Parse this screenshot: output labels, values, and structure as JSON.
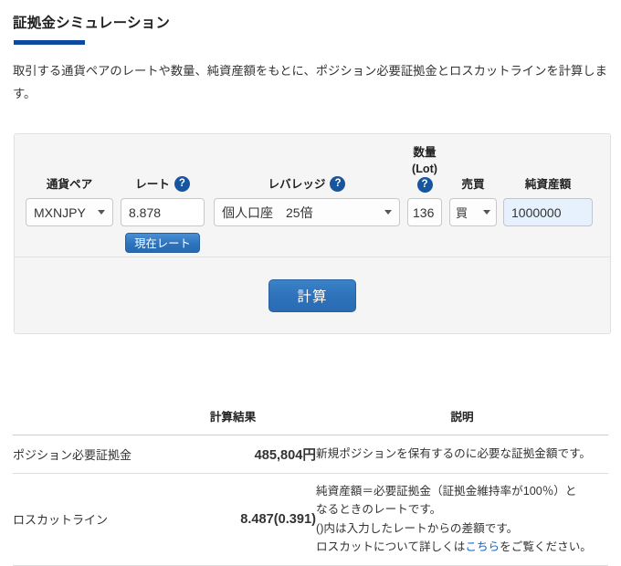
{
  "header": {
    "title": "証拠金シミュレーション",
    "lead": "取引する通貨ペアのレートや数量、純資産額をもとに、ポジション必要証拠金とロスカットラインを計算します。",
    "accent_color": "#0b4a9e"
  },
  "form": {
    "labels": {
      "pair": "通貨ペア",
      "rate": "レート",
      "leverage": "レバレッジ",
      "quantity_line1": "数量",
      "quantity_line2": "(Lot)",
      "side": "売買",
      "equity": "純資産額"
    },
    "help_icon": "?",
    "values": {
      "pair": "MXNJPY",
      "rate": "8.878",
      "leverage": "個人口座　25倍",
      "quantity": "136",
      "side": "買",
      "equity": "1000000"
    },
    "buttons": {
      "current_rate": "現在レート",
      "calculate": "計算"
    },
    "colors": {
      "panel_bg": "#f5f5f5",
      "button_blue": "#2d72bb",
      "help_blue": "#18559f",
      "equity_highlight": "#e7f0fd"
    }
  },
  "results": {
    "headers": {
      "name": "",
      "result": "計算結果",
      "description": "説明"
    },
    "rows": [
      {
        "name": "ポジション必要証拠金",
        "value": "485,804円",
        "desc_lines": [
          "新規ポジションを保有するのに必要な証拠金額です。"
        ],
        "link_text": "",
        "desc_tail": ""
      },
      {
        "name": "ロスカットライン",
        "value": "8.487(0.391)",
        "desc_lines": [
          "純資産額＝必要証拠金（証拠金維持率が100％）と",
          "なるときのレートです。",
          "()内は入力したレートからの差額です。"
        ],
        "desc_link_prefix": "ロスカットについて詳しくは",
        "link_text": "こちら",
        "desc_tail": "をご覧ください。"
      }
    ],
    "link_color": "#1565c0"
  }
}
